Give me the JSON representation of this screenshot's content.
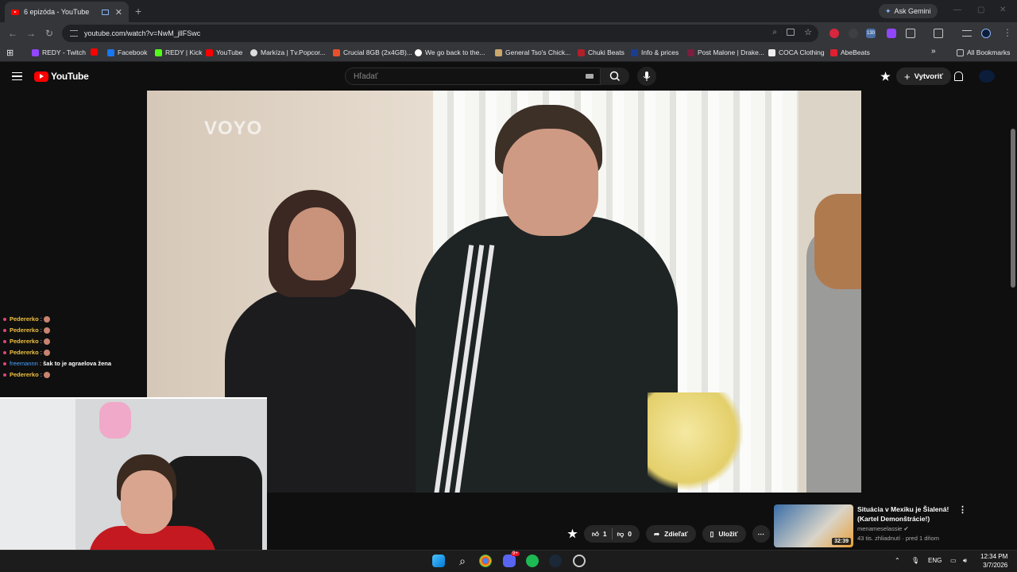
{
  "browser": {
    "tab_title": "6 epizóda - YouTube",
    "url": "youtube.com/watch?v=NwM_jllFSwc",
    "gemini_label": "Ask Gemini",
    "bookmarks": [
      "REDY - Twitch",
      "",
      "Facebook",
      "REDY | Kick",
      "YouTube",
      "Markíza | Tv.Popcor...",
      "Crucial 8GB (2x4GB)...",
      "We go back to the...",
      "General Tso's Chick...",
      "Chuki Beats",
      "Info & prices",
      "Post Malone | Drake...",
      "COCA Clothing",
      "AbeBeats"
    ],
    "all_bookmarks": "All Bookmarks",
    "ext_badge": "130"
  },
  "youtube": {
    "logo": "YouTube",
    "search_placeholder": "Hľadať",
    "create_label": "Vytvoriť"
  },
  "video": {
    "watermark": "VOYO"
  },
  "chat": [
    {
      "user": "Pedererko",
      "msg": ""
    },
    {
      "user": "Pedererko",
      "msg": ""
    },
    {
      "user": "Pedererko",
      "msg": ""
    },
    {
      "user": "Pedererko",
      "msg": ""
    },
    {
      "user": "freemannn",
      "msg": "šak to je agraelova žena"
    },
    {
      "user": "Pedererko",
      "msg": ""
    }
  ],
  "actions": {
    "likes": "1",
    "dislikes": "0",
    "share": "Zdieľať",
    "save": "Uložiť"
  },
  "suggestion": {
    "title": "Situácia v Mexiku je Šialená! (Kartel Demonštrácie!)",
    "channel": "menameselassie",
    "meta": "43 tis. zhliadnutí · pred 1 dňom",
    "duration": "32:39"
  },
  "taskbar": {
    "lang": "ENG",
    "time": "12:34 PM",
    "date": "3/7/2026",
    "discord_badge": "9+"
  }
}
